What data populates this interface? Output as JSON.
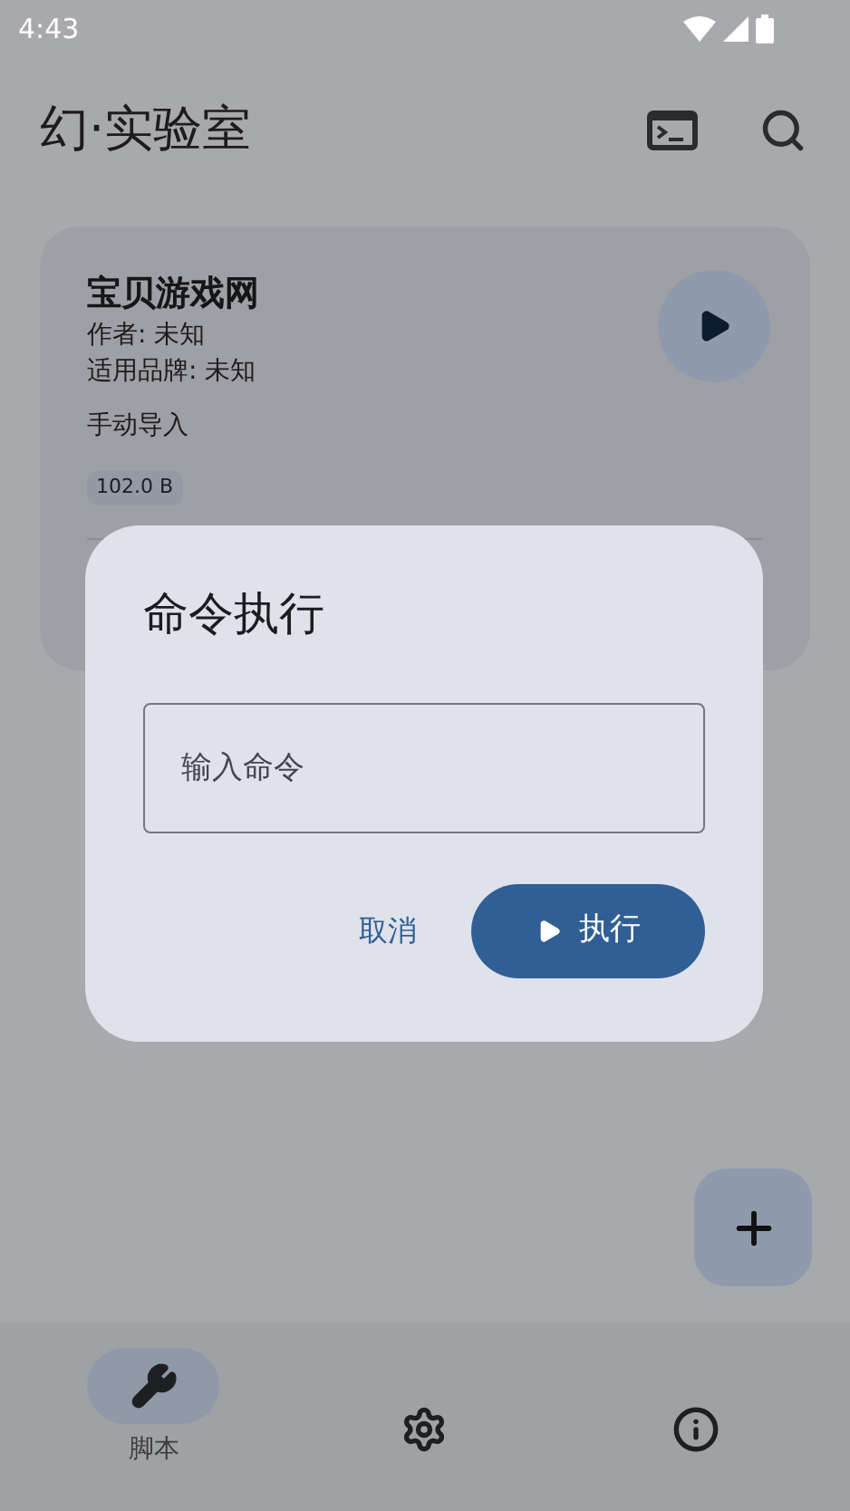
{
  "status_bar": {
    "time": "4:43"
  },
  "app_bar": {
    "title": "幻·实验室"
  },
  "script_card": {
    "title": "宝贝游戏网",
    "author": "作者: 未知",
    "brand": "适用品牌: 未知",
    "source": "手动导入",
    "size": "102.0 B"
  },
  "dialog": {
    "title": "命令执行",
    "input": {
      "placeholder": "输入命令"
    },
    "cancel": "取消",
    "confirm": "执行"
  },
  "bottom_nav": [
    {
      "label": "脚本",
      "selected": true
    },
    {
      "selected": false
    },
    {
      "selected": false
    }
  ]
}
